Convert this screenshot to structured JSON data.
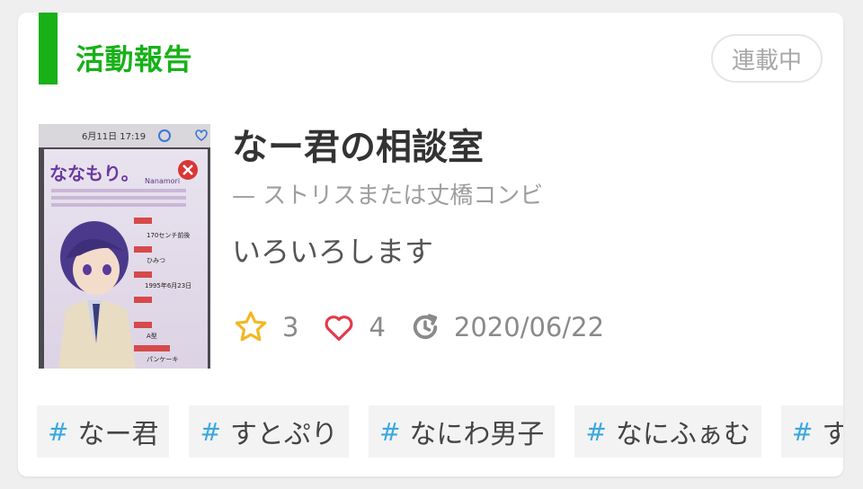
{
  "section": {
    "label": "活動報告",
    "status": "連載中"
  },
  "story": {
    "cover_alt": "cover-image",
    "title": "なー君の相談室",
    "author": "— ストリスまたは丈橋コンビ",
    "description": "いろいろします",
    "stats": {
      "stars": "3",
      "likes": "4",
      "updated": "2020/06/22"
    }
  },
  "cover_text": {
    "time": "6月11日 17:19",
    "name": "ななもり。",
    "name_en": "Nanamori",
    "height": "170センチ前後",
    "secret": "ひみつ",
    "birthday": "1995年6月23日",
    "blood": "A型",
    "food": "パンケーキ"
  },
  "tags": [
    "なー君",
    "すとぷり",
    "なにわ男子",
    "なにふぁむ",
    "す"
  ],
  "colors": {
    "accent": "#18b118",
    "star": "#f5b623",
    "heart": "#e33b4a",
    "hash": "#39a8e0"
  }
}
